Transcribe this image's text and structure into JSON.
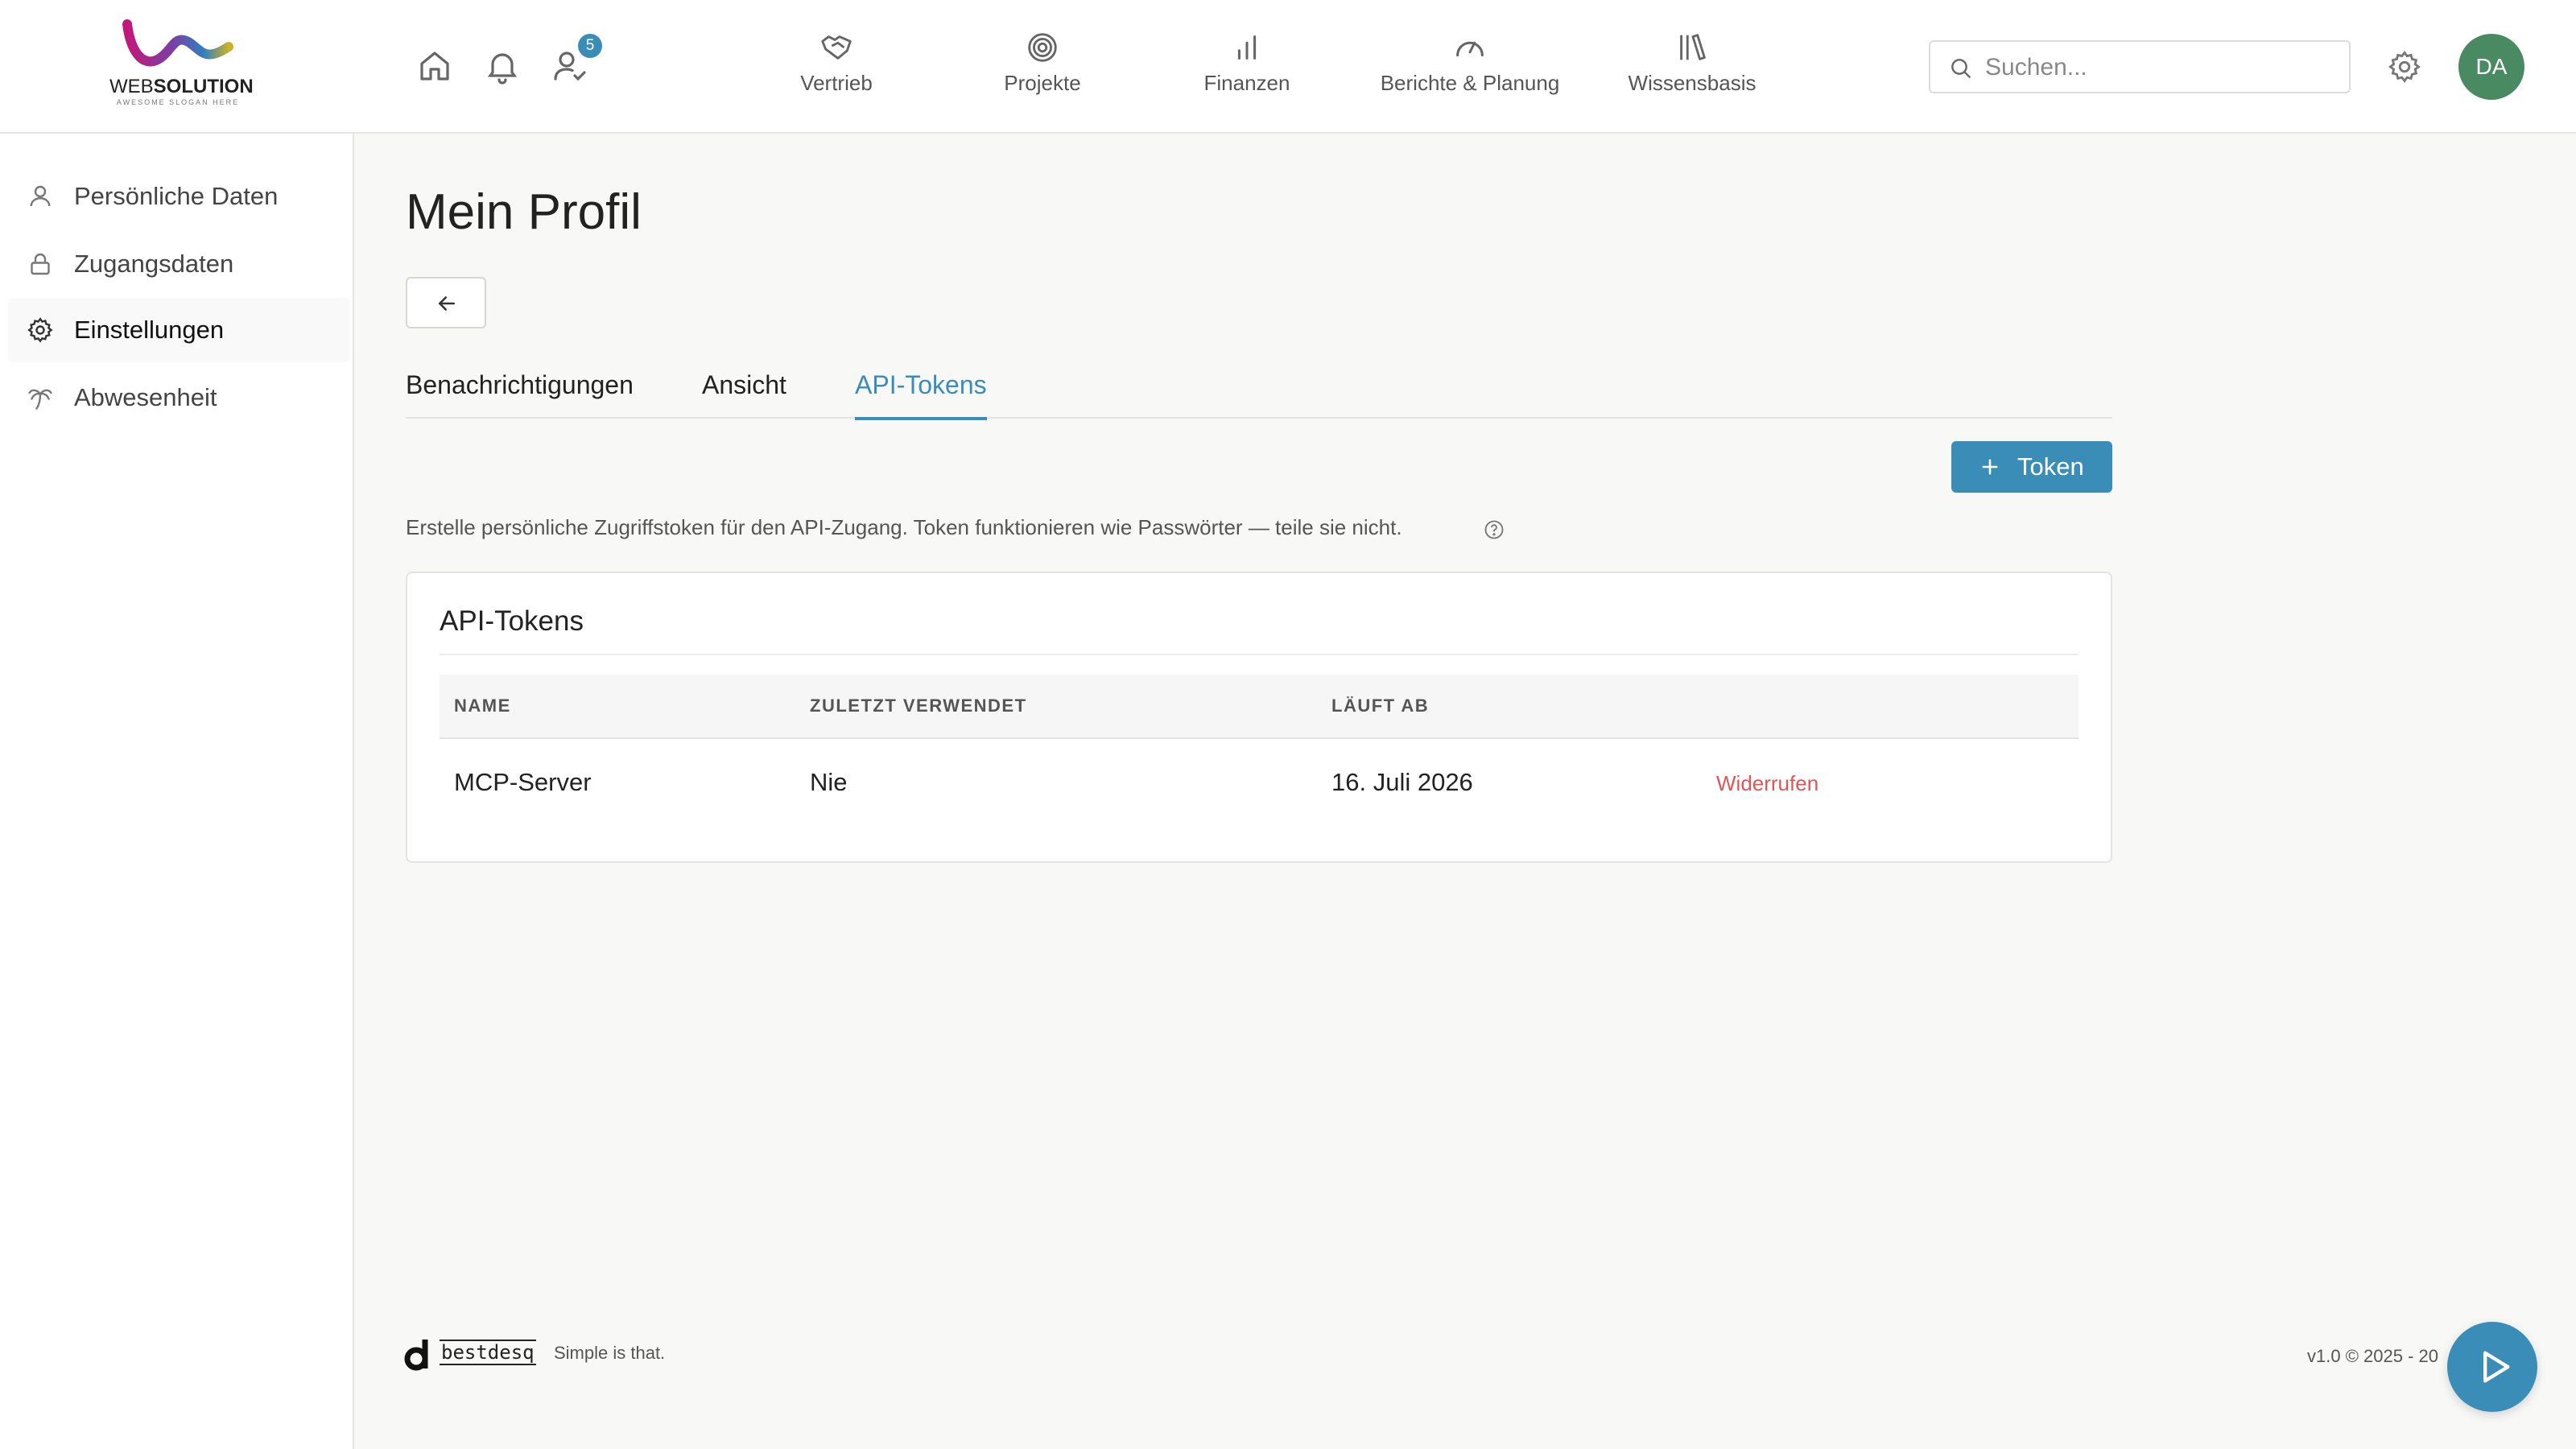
{
  "brand": {
    "logo_name_light": "WEB",
    "logo_name_bold": "SOLUTION",
    "logo_slogan": "AWESOME SLOGAN HERE"
  },
  "header": {
    "notification_badge": "5",
    "nav": [
      {
        "label": "Vertrieb",
        "icon": "handshake-icon"
      },
      {
        "label": "Projekte",
        "icon": "target-icon"
      },
      {
        "label": "Finanzen",
        "icon": "bar-chart-icon"
      },
      {
        "label": "Berichte & Planung",
        "icon": "gauge-icon"
      },
      {
        "label": "Wissensbasis",
        "icon": "library-icon"
      }
    ],
    "search_placeholder": "Suchen...",
    "avatar_initials": "DA"
  },
  "sidebar": {
    "items": [
      {
        "label": "Persönliche Daten",
        "icon": "user-icon"
      },
      {
        "label": "Zugangsdaten",
        "icon": "lock-icon"
      },
      {
        "label": "Einstellungen",
        "icon": "gear-icon"
      },
      {
        "label": "Abwesenheit",
        "icon": "palm-tree-icon"
      }
    ],
    "active": "Einstellungen"
  },
  "main": {
    "title": "Mein Profil",
    "tabs": [
      {
        "label": "Benachrichtigungen"
      },
      {
        "label": "Ansicht"
      },
      {
        "label": "API-Tokens"
      }
    ],
    "active_tab": "API-Tokens",
    "add_token_label": "Token",
    "hint": "Erstelle persönliche Zugriffstoken für den API-Zugang. Token funktionieren wie Passwörter — teile sie nicht.",
    "card": {
      "title": "API-Tokens",
      "columns": [
        "NAME",
        "ZULETZT VERWENDET",
        "LÄUFT AB"
      ],
      "rows": [
        {
          "name": "MCP-Server",
          "last_used": "Nie",
          "expires": "16. Juli 2026",
          "action": "Widerrufen"
        }
      ]
    }
  },
  "footer": {
    "product_name": "bestdesq",
    "product_slogan": "Simple is that.",
    "version": "v1.0 © 2025 - 20"
  },
  "colors": {
    "accent": "#3a8db7",
    "danger": "#e05656",
    "avatar": "#4a8a62"
  }
}
